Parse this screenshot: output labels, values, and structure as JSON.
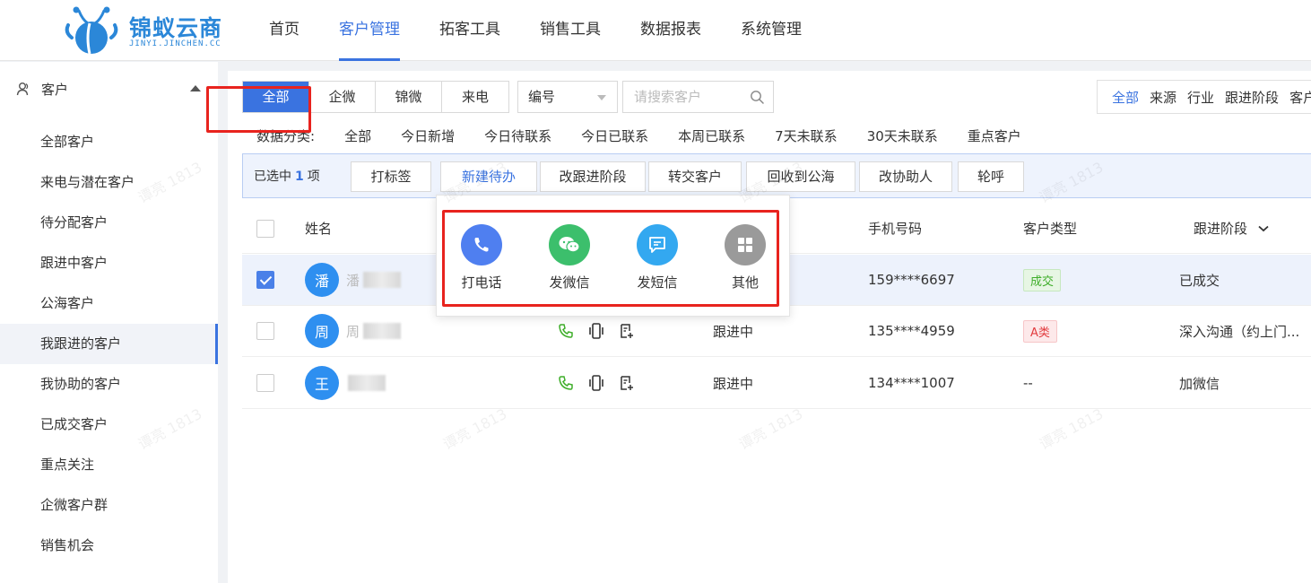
{
  "brand": {
    "name": "锦蚁云商",
    "sub": "JINYI.JINCHEN.CC",
    "color": "#2b87d8"
  },
  "nav": {
    "items": [
      {
        "label": "首页",
        "active": false
      },
      {
        "label": "客户管理",
        "active": true
      },
      {
        "label": "拓客工具",
        "active": false
      },
      {
        "label": "销售工具",
        "active": false
      },
      {
        "label": "数据报表",
        "active": false
      },
      {
        "label": "系统管理",
        "active": false
      }
    ]
  },
  "sidebar": {
    "section_label": "客户",
    "items": [
      {
        "label": "全部客户",
        "active": false
      },
      {
        "label": "来电与潜在客户",
        "active": false
      },
      {
        "label": "待分配客户",
        "active": false
      },
      {
        "label": "跟进中客户",
        "active": false
      },
      {
        "label": "公海客户",
        "active": false
      },
      {
        "label": "我跟进的客户",
        "active": true
      },
      {
        "label": "我协助的客户",
        "active": false
      },
      {
        "label": "已成交客户",
        "active": false
      },
      {
        "label": "重点关注",
        "active": false
      },
      {
        "label": "企微客户群",
        "active": false
      },
      {
        "label": "销售机会",
        "active": false
      }
    ]
  },
  "tabs": {
    "items": [
      {
        "label": "全部",
        "active": true
      },
      {
        "label": "企微",
        "active": false
      },
      {
        "label": "锦微",
        "active": false
      },
      {
        "label": "来电",
        "active": false
      }
    ]
  },
  "search": {
    "field_value": "编号",
    "placeholder": "请搜索客户"
  },
  "filters": {
    "items": [
      {
        "label": "全部",
        "active": true
      },
      {
        "label": "来源",
        "active": false
      },
      {
        "label": "行业",
        "active": false
      },
      {
        "label": "跟进阶段",
        "active": false
      },
      {
        "label": "客户",
        "active": false
      }
    ]
  },
  "categories": {
    "label": "数据分类:",
    "items": [
      "全部",
      "今日新增",
      "今日待联系",
      "今日已联系",
      "本周已联系",
      "7天未联系",
      "30天未联系",
      "重点客户"
    ]
  },
  "actionbar": {
    "selected_prefix": "已选中",
    "selected_count": "1",
    "selected_suffix": "项",
    "buttons": [
      "打标签",
      "新建待办",
      "改跟进阶段",
      "转交客户",
      "回收到公海",
      "改协助人",
      "轮呼"
    ]
  },
  "table": {
    "headers": {
      "name": "姓名",
      "phone": "手机号码",
      "type": "客户类型",
      "stage": "跟进阶段"
    },
    "rows": [
      {
        "avatar": "潘",
        "name_initial": "潘",
        "status": "",
        "phone": "159****6697",
        "type": "成交",
        "type_color": "green",
        "stage": "已成交",
        "checked": true
      },
      {
        "avatar": "周",
        "name_initial": "周",
        "status": "跟进中",
        "phone": "135****4959",
        "type": "A类",
        "type_color": "red",
        "stage": "深入沟通（约上门...",
        "checked": false
      },
      {
        "avatar": "王",
        "name_initial": "",
        "status": "跟进中",
        "phone": "134****1007",
        "type": "--",
        "type_color": "",
        "stage": "加微信",
        "checked": false
      }
    ]
  },
  "popover": {
    "items": [
      {
        "label": "打电话",
        "icon": "phone-icon",
        "color": "#4f7ff0"
      },
      {
        "label": "发微信",
        "icon": "wechat-icon",
        "color": "#3cbf6c"
      },
      {
        "label": "发短信",
        "icon": "sms-icon",
        "color": "#33a8f0"
      },
      {
        "label": "其他",
        "icon": "grid-icon",
        "color": "#9a9a9a"
      }
    ]
  },
  "watermark": "谭亮 1813",
  "colors": {
    "accent": "#3a73e0",
    "highlight_frame": "#e8231e"
  }
}
